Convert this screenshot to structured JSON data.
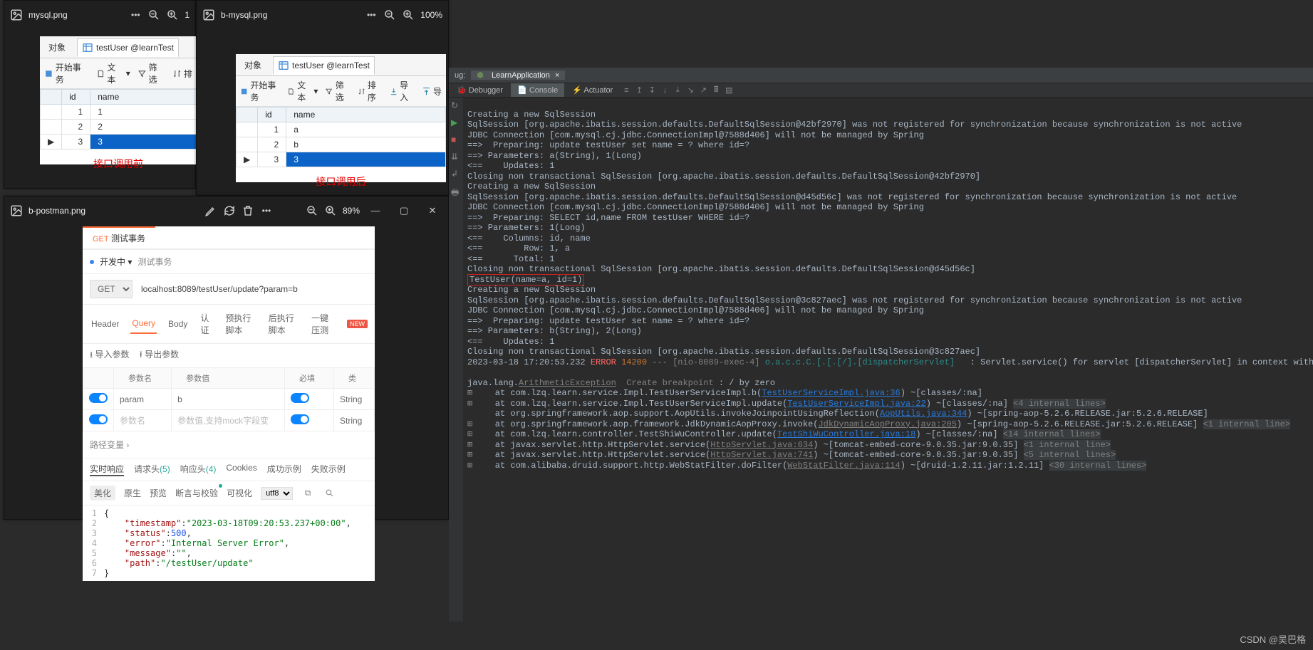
{
  "windows": {
    "mysql_before": {
      "filename": "mysql.png",
      "zoom_partial": "1",
      "tabs": {
        "objects": "对象",
        "table": "testUser @learnTest"
      },
      "toolbar": {
        "begin": "开始事务",
        "text": "文本",
        "filter": "筛选",
        "sort": "排"
      },
      "cols": {
        "id": "id",
        "name": "name"
      },
      "rows": [
        {
          "id": "1",
          "name": "1"
        },
        {
          "id": "2",
          "name": "2"
        },
        {
          "id": "3",
          "name": "3"
        }
      ],
      "caption": "接口调用前"
    },
    "mysql_after": {
      "filename": "b-mysql.png",
      "zoom": "100%",
      "tabs": {
        "objects": "对象",
        "table": "testUser @learnTest"
      },
      "toolbar": {
        "begin": "开始事务",
        "text": "文本",
        "filter": "筛选",
        "sort": "排序",
        "import": "导入",
        "export": "导"
      },
      "cols": {
        "id": "id",
        "name": "name"
      },
      "rows": [
        {
          "id": "1",
          "name": "a"
        },
        {
          "id": "2",
          "name": "b"
        },
        {
          "id": "3",
          "name": "3"
        }
      ],
      "caption": "接口调用后"
    },
    "postman": {
      "filename": "b-postman.png",
      "zoom": "89%",
      "tab_method": "GET",
      "tab_title": "测试事务",
      "env": "开发中",
      "breadcrumb": "测试事务",
      "method": "GET",
      "url": "localhost:8089/testUser/update?param=b",
      "subtabs": {
        "header": "Header",
        "query": "Query",
        "body": "Body",
        "auth": "认证",
        "pre": "预执行脚本",
        "post": "后执行脚本",
        "one": "一键压测"
      },
      "import_param": "导入参数",
      "export_param": "导出参数",
      "pheaders": {
        "name": "参数名",
        "value": "参数值",
        "req": "必填",
        "type": "类"
      },
      "param_rows": [
        {
          "name": "param",
          "value": "b",
          "type": "String"
        }
      ],
      "placeholder_name": "参数名",
      "placeholder_value": "参数值,支持mock字段变",
      "placeholder_type": "String",
      "path_var": "路径变量",
      "resp_tabs": {
        "live": "实时响应",
        "reqh": "请求头",
        "resph": "响应头",
        "cookies": "Cookies",
        "succ": "成功示例",
        "fail": "失败示例"
      },
      "reqh_count": "(5)",
      "resph_count": "(4)",
      "fmt": {
        "beautify": "美化",
        "raw": "原生",
        "preview": "预览",
        "assert": "断言与校验",
        "visual": "可视化",
        "enc": "utf8"
      },
      "json": {
        "timestamp": "2023-03-18T09:20:53.237+00:00",
        "status": 500,
        "error": "Internal Server Error",
        "message": "",
        "path": "/testUser/update"
      }
    }
  },
  "ide": {
    "run_config": "LearnApplication",
    "debug_label": "ug:",
    "tabs": {
      "debugger": "Debugger",
      "console": "Console",
      "actuator": "Actuator"
    },
    "log": {
      "l1": "Creating a new SqlSession",
      "l2": "SqlSession [org.apache.ibatis.session.defaults.DefaultSqlSession@42bf2970] was not registered for synchronization because synchronization is not active",
      "l3": "JDBC Connection [com.mysql.cj.jdbc.ConnectionImpl@7588d406] will not be managed by Spring",
      "l4": "==>  Preparing: update testUser set name = ? where id=?",
      "l5": "==> Parameters: a(String), 1(Long)",
      "l6": "<==    Updates: 1",
      "l7": "Closing non transactional SqlSession [org.apache.ibatis.session.defaults.DefaultSqlSession@42bf2970]",
      "l8": "Creating a new SqlSession",
      "l9": "SqlSession [org.apache.ibatis.session.defaults.DefaultSqlSession@d45d56c] was not registered for synchronization because synchronization is not active",
      "l10": "JDBC Connection [com.mysql.cj.jdbc.ConnectionImpl@7588d406] will not be managed by Spring",
      "l11": "==>  Preparing: SELECT id,name FROM testUser WHERE id=?",
      "l12": "==> Parameters: 1(Long)",
      "l13": "<==    Columns: id, name",
      "l14": "<==        Row: 1, a",
      "l15": "<==      Total: 1",
      "l16": "Closing non transactional SqlSession [org.apache.ibatis.session.defaults.DefaultSqlSession@d45d56c]",
      "l17": "TestUser(name=a, id=1)",
      "l18": "Creating a new SqlSession",
      "l19": "SqlSession [org.apache.ibatis.session.defaults.DefaultSqlSession@3c827aec] was not registered for synchronization because synchronization is not active",
      "l20": "JDBC Connection [com.mysql.cj.jdbc.ConnectionImpl@7588d406] will not be managed by Spring",
      "l21": "==>  Preparing: update testUser set name = ? where id=?",
      "l22": "==> Parameters: b(String), 2(Long)",
      "l23": "<==    Updates: 1",
      "l24": "Closing non transactional SqlSession [org.apache.ibatis.session.defaults.DefaultSqlSession@3c827aec]",
      "err_ts": "2023-03-18 17:20:53.232",
      "err_lvl": "ERROR",
      "err_code": "14200",
      "err_mid": " --- [nio-8089-exec-4] ",
      "err_logger": "o.a.c.c.C.[.[.[/].[dispatcherServlet]",
      "err_msg": "   : Servlet.service() for servlet [dispatcherServlet] in context with path",
      "exc": "java.lang.",
      "exc_name": "ArithmeticException",
      "exc_bp": "Create breakpoint",
      "exc_tail": " : / by zero",
      "st1a": "    at com.lzq.learn.service.Impl.TestUserServiceImpl.b(",
      "st1l": "TestUserServiceImpl.java:36",
      "st1b": ") ~[classes/:na]",
      "st2a": "    at com.lzq.learn.service.Impl.TestUserServiceImpl.update(",
      "st2l": "TestUserServiceImpl.java:22",
      "st2b": ") ~[classes/:na] ",
      "st2c": "<4 internal lines>",
      "st3a": "    at org.springframework.aop.support.AopUtils.invokeJoinpointUsingReflection(",
      "st3l": "AopUtils.java:344",
      "st3b": ") ~[spring-aop-5.2.6.RELEASE.jar:5.2.6.RELEASE]",
      "st4a": "    at org.springframework.aop.framework.JdkDynamicAopProxy.invoke(",
      "st4l": "JdkDynamicAopProxy.java:205",
      "st4b": ") ~[spring-aop-5.2.6.RELEASE.jar:5.2.6.RELEASE] ",
      "st4c": "<1 internal line>",
      "st5a": "    at com.lzq.learn.controller.TestShiWuController.update(",
      "st5l": "TestShiWuController.java:18",
      "st5b": ") ~[classes/:na] ",
      "st5c": "<14 internal lines>",
      "st6a": "    at javax.servlet.http.HttpServlet.service(",
      "st6l": "HttpServlet.java:634",
      "st6b": ") ~[tomcat-embed-core-9.0.35.jar:9.0.35] ",
      "st6c": "<1 internal line>",
      "st7a": "    at javax.servlet.http.HttpServlet.service(",
      "st7l": "HttpServlet.java:741",
      "st7b": ") ~[tomcat-embed-core-9.0.35.jar:9.0.35] ",
      "st7c": "<5 internal lines>",
      "st8a": "    at com.alibaba.druid.support.http.WebStatFilter.doFilter(",
      "st8l": "WebStatFilter.java:114",
      "st8b": ") ~[druid-1.2.11.jar:1.2.11] ",
      "st8c": "<30 internal lines>"
    }
  },
  "watermark": "CSDN @吴巴格"
}
